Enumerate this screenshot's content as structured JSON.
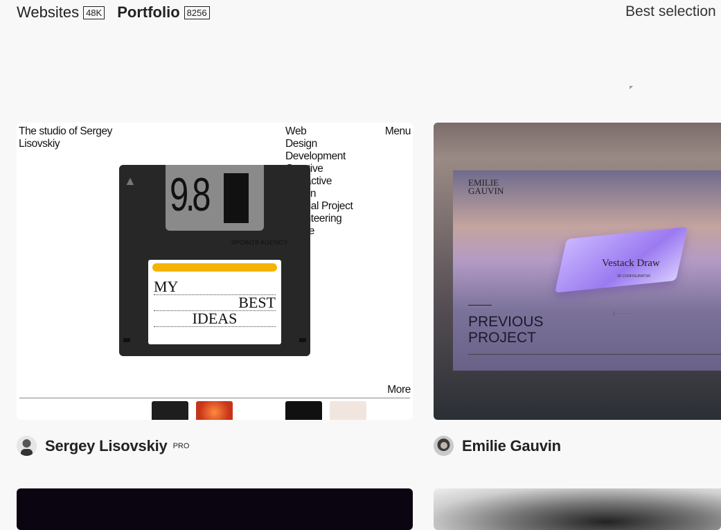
{
  "nav": {
    "tabs": [
      {
        "label": "Websites",
        "count": "48K"
      },
      {
        "label": "Portfolio",
        "count": "8256"
      }
    ],
    "best_selection": "Best selection"
  },
  "cards": [
    {
      "author": "Sergey Lisovskiy",
      "badge": "PRO",
      "preview": {
        "title": "The studio of Sergey Lisovskiy",
        "menu": "Menu",
        "more": "More",
        "categories": [
          "Web",
          "Design",
          "Development",
          "Creative",
          "Interactive",
          "Motion",
          "Special Project",
          "Volunteering",
          "Peace"
        ],
        "floppy_number": "9.8",
        "agency": "9POINT8 AGENCY",
        "label_words": [
          "MY",
          "BEST",
          "IDEAS"
        ]
      }
    },
    {
      "author": "Emilie Gauvin",
      "preview": {
        "logo_line1": "EMILIE",
        "logo_line2": "GAUVIN",
        "project_title": "Vestack Draw",
        "project_sub": "3D CONFIGURATOR",
        "prev_line1": "PREVIOUS",
        "prev_line2": "PROJECT"
      }
    }
  ],
  "colors": {
    "background": "#f8f8f8",
    "floppy_label_bar": "#f4b400",
    "floppy_body": "#272727"
  }
}
